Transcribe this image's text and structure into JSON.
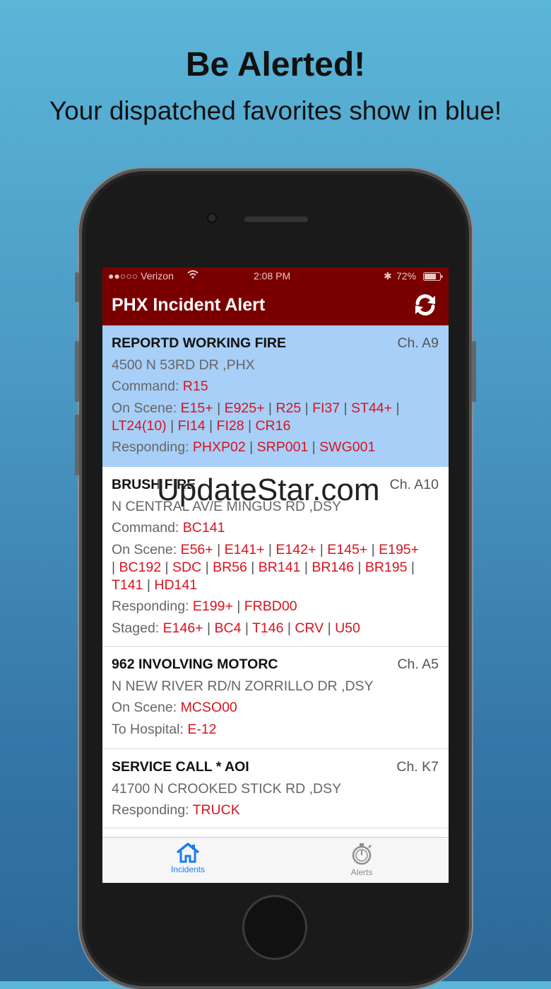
{
  "promo": {
    "headline": "Be Alerted!",
    "subline": "Your dispatched favorites show in blue!"
  },
  "status_bar": {
    "carrier": "●●○○○ Verizon",
    "time": "2:08 PM",
    "battery": "72%"
  },
  "app": {
    "title": "PHX Incident Alert",
    "refresh_icon": "refresh-icon"
  },
  "incidents": [
    {
      "title": "REPORTD WORKING FIRE",
      "channel": "Ch. A9",
      "address": "4500 N 53RD DR ,PHX",
      "favorite": true,
      "lines": [
        {
          "label": "Command: ",
          "units": [
            "R15"
          ]
        },
        {
          "label": "On Scene: ",
          "units": [
            "E15+",
            "E925+",
            "R25",
            "FI37",
            "ST44+"
          ],
          "trailing_sep": true
        },
        {
          "label": "",
          "units": [
            "LT24(10)",
            "FI14",
            "FI28",
            "CR16"
          ]
        },
        {
          "label": "Responding: ",
          "units": [
            "PHXP02",
            "SRP001",
            "SWG001"
          ]
        }
      ]
    },
    {
      "title": "BRUSH FIRE",
      "channel": "Ch. A10",
      "address": "N CENTRAL AV/E MINGUS RD ,DSY",
      "favorite": false,
      "lines": [
        {
          "label": "Command: ",
          "units": [
            "BC141"
          ]
        },
        {
          "label": "On Scene: ",
          "units": [
            "E56+",
            "E141+",
            "E142+",
            "E145+",
            "E195+"
          ]
        },
        {
          "label": "",
          "leading_sep": true,
          "units": [
            "BC192",
            "SDC",
            "BR56",
            "BR141",
            "BR146",
            "BR195"
          ],
          "trailing_sep": true
        },
        {
          "label": "",
          "units": [
            "T141",
            "HD141"
          ]
        },
        {
          "label": "Responding: ",
          "units": [
            "E199+",
            "FRBD00"
          ]
        },
        {
          "label": "Staged: ",
          "units": [
            "E146+",
            "BC4",
            "T146",
            "CRV",
            "U50"
          ]
        }
      ]
    },
    {
      "title": "962 INVOLVING MOTORC",
      "channel": "Ch. A5",
      "address": "N NEW RIVER RD/N ZORRILLO DR ,DSY",
      "favorite": false,
      "lines": [
        {
          "label": "On Scene: ",
          "units": [
            "MCSO00"
          ]
        },
        {
          "label": "To Hospital: ",
          "units": [
            "E-12"
          ]
        }
      ]
    },
    {
      "title": "SERVICE CALL * AOI",
      "channel": "Ch. K7",
      "address": "41700 N CROOKED STICK RD ,DSY",
      "favorite": false,
      "lines": [
        {
          "label": "Responding: ",
          "units": [
            "TRUCK"
          ]
        }
      ]
    }
  ],
  "tabs": [
    {
      "label": "Incidents",
      "icon": "home-icon",
      "active": true
    },
    {
      "label": "Alerts",
      "icon": "stopwatch-icon",
      "active": false
    }
  ],
  "colors": {
    "nav": "#7a0000",
    "favorite_bg": "#a7cff7",
    "unit": "#d8141f",
    "tab_active": "#1a7cf2"
  },
  "watermark": "UpdateStar.com"
}
